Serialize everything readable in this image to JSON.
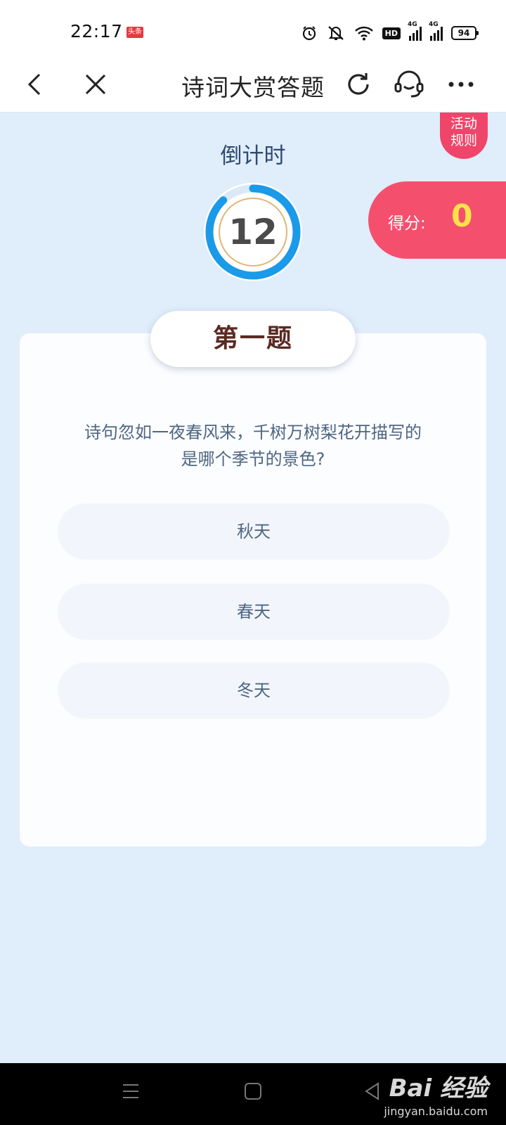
{
  "status_bar": {
    "time": "22:17",
    "news_badge": "头条",
    "hd_label": "HD",
    "net_1": "4G",
    "net_2": "4G",
    "battery": "94"
  },
  "nav": {
    "title": "诗词大赏答题",
    "icons": [
      "back-icon",
      "close-icon",
      "refresh-icon",
      "customer-service-icon",
      "more-icon"
    ]
  },
  "countdown": {
    "label": "倒计时",
    "value": "12",
    "progress": 0.88
  },
  "rules": {
    "line1": "活动",
    "line2": "规则"
  },
  "score": {
    "label": "得分:",
    "value": "0"
  },
  "quiz": {
    "title": "第一题",
    "question_line1": "诗句忽如一夜春风来，千树万树梨花开描写的",
    "question_line2": "是哪个季节的景色?",
    "options": [
      "秋天",
      "春天",
      "冬天"
    ]
  },
  "watermark": {
    "main": "Bai 经验",
    "sub": "jingyan.baidu.com"
  },
  "colors": {
    "page_bg": "#e0edfb",
    "accent_pink": "#f4506e",
    "score_yellow": "#ffe24a",
    "timer_blue": "#1a9ae8",
    "title_brown": "#5a2a22"
  }
}
